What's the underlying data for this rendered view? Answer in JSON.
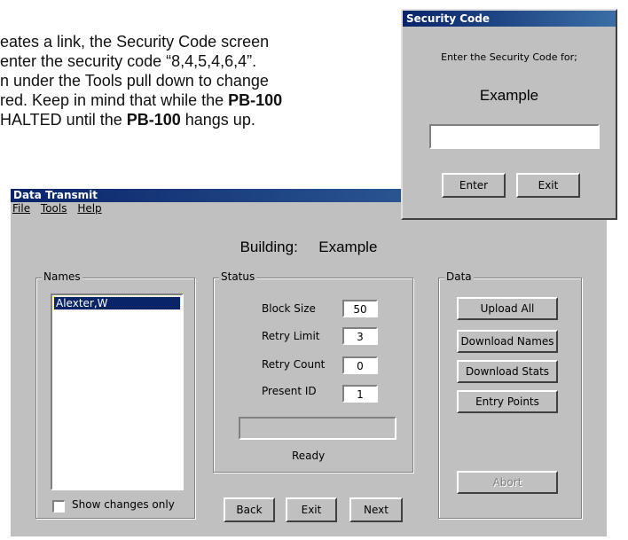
{
  "document": {
    "lines": [
      {
        "pre": "eates a link, the Security Code screen",
        "bold": "",
        "post": ""
      },
      {
        "pre": "enter the security code “8,4,5,4,6,4”.",
        "bold": "",
        "post": ""
      },
      {
        "pre": "n under the Tools pull down to change",
        "bold": "",
        "post": ""
      },
      {
        "pre": "red. Keep in mind that while the ",
        "bold": "PB-100",
        "post": ""
      },
      {
        "pre": "HALTED until the ",
        "bold": "PB-100",
        "post": " hangs up."
      }
    ]
  },
  "security_dialog": {
    "title": "Security Code",
    "prompt": "Enter the Security Code for;",
    "building": "Example",
    "code_value": "",
    "enter_label": "Enter",
    "exit_label": "Exit"
  },
  "transmit_window": {
    "title": "Data Transmit",
    "menu": [
      "File",
      "Tools",
      "Help"
    ],
    "building_label": "Building:",
    "building_name": "Example",
    "names_group": {
      "label": "Names",
      "items": [
        "Alexter,W"
      ],
      "show_changes_label": "Show changes only",
      "show_changes_checked": false
    },
    "status_group": {
      "label": "Status",
      "block_size_label": "Block Size",
      "block_size": "50",
      "retry_limit_label": "Retry Limit",
      "retry_limit": "3",
      "retry_count_label": "Retry Count",
      "retry_count": "0",
      "present_id_label": "Present ID",
      "present_id": "1",
      "progress": 0,
      "status_text": "Ready"
    },
    "data_group": {
      "label": "Data",
      "upload_all": "Upload All",
      "download_names": "Download Names",
      "download_stats": "Download Stats",
      "entry_points": "Entry Points",
      "abort": "Abort"
    },
    "nav": {
      "back": "Back",
      "exit": "Exit",
      "next": "Next"
    }
  },
  "colors": {
    "titlebar_start": "#0a246a",
    "titlebar_end": "#3a6ea5",
    "selection": "#0a246a",
    "face": "#c0c0c0"
  }
}
